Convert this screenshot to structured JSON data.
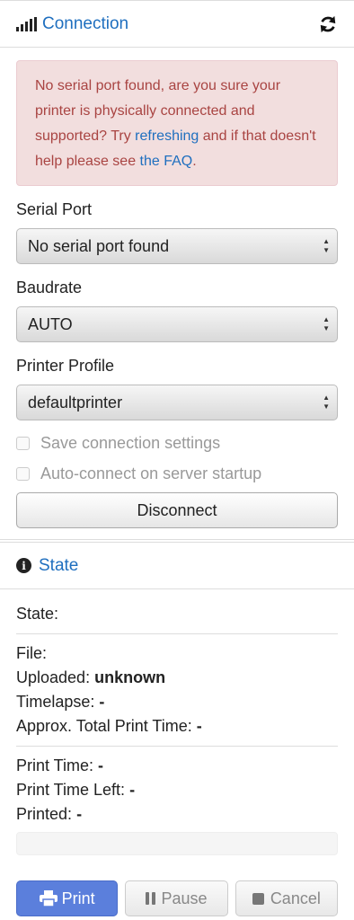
{
  "connection": {
    "title": "Connection",
    "alert": {
      "text_before": "No serial port found, are you sure your printer is physically connected and supported? Try ",
      "link_refresh": "refreshing",
      "text_middle": " and if that doesn't help please see ",
      "link_faq": "the FAQ",
      "text_after": "."
    },
    "serial_port": {
      "label": "Serial Port",
      "value": "No serial port found"
    },
    "baudrate": {
      "label": "Baudrate",
      "value": "AUTO"
    },
    "printer_profile": {
      "label": "Printer Profile",
      "value": "defaultprinter"
    },
    "save_settings_label": "Save connection settings",
    "autoconnect_label": "Auto-connect on server startup",
    "disconnect_label": "Disconnect"
  },
  "state": {
    "title": "State",
    "state_label": "State:",
    "file_label": "File:",
    "uploaded_label": "Uploaded:",
    "uploaded_value": "unknown",
    "timelapse_label": "Timelapse:",
    "timelapse_value": "-",
    "approx_total_label": "Approx. Total Print Time:",
    "approx_total_value": "-",
    "print_time_label": "Print Time:",
    "print_time_value": "-",
    "print_time_left_label": "Print Time Left:",
    "print_time_left_value": "-",
    "printed_label": "Printed:",
    "printed_value": "-",
    "progress": 0
  },
  "buttons": {
    "print": "Print",
    "pause": "Pause",
    "cancel": "Cancel"
  },
  "colors": {
    "link": "#1f6fbf",
    "alert_bg": "#f2dede",
    "alert_text": "#a94442",
    "print_button": "#5b7fdc"
  },
  "icons": {
    "connection": "signal-icon",
    "refresh": "refresh-icon",
    "state": "info-icon",
    "print": "printer-icon",
    "pause": "pause-icon",
    "cancel": "stop-icon"
  }
}
